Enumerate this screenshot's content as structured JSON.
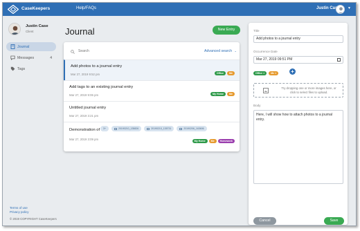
{
  "header": {
    "brand": "CaseKeepers",
    "help_link": "Help/FAQs",
    "user_name": "Justin Case"
  },
  "sidebar": {
    "user_name": "Justin Case",
    "user_role": "Client",
    "items": [
      {
        "label": "Journal",
        "icon": "book-icon",
        "active": true
      },
      {
        "label": "Messages",
        "icon": "chat-icon",
        "count": "4"
      },
      {
        "label": "Tags",
        "icon": "tag-icon"
      }
    ],
    "footer_links": [
      "Terms of use",
      "Privacy policy"
    ],
    "copyright": "© 2019 COPYRIGHT CaseKeepers"
  },
  "journal": {
    "title": "Journal",
    "new_entry_label": "New Entry",
    "search_placeholder": "Search",
    "advanced_search_label": "Advanced search",
    "entries": [
      {
        "title": "Add photos to a journal entry",
        "date": "Mar 27, 2019 9:52 pm",
        "tags": [
          "Office",
          "Me"
        ]
      },
      {
        "title": "Add tags to an existing journal entry",
        "date": "Mar 27, 2019 9:06 pm",
        "tags": [
          "My Home",
          "Me"
        ]
      },
      {
        "title": "Untitled journal entry",
        "date": "Mar 27, 2019 3:21 pm",
        "tags": []
      },
      {
        "title": "Demonstration of a ...",
        "date": "Mar 27, 2019 3:09 pm",
        "tags": [
          "My Home",
          "Me",
          "Homework"
        ],
        "attachments": [
          "3+",
          "20190210_135826",
          "20190210_135731",
          "20190206_163606"
        ]
      }
    ]
  },
  "editor": {
    "title_label": "Title",
    "title_value": "Add photos to a journal entry",
    "date_label": "Occurrence Date",
    "date_value": "Mar 27, 2019 09:51 PM",
    "tags": [
      "Office",
      "Me"
    ],
    "dropzone_text": "Try dropping one or more images here, or click to select files to upload.",
    "body_label": "Body",
    "body_value": "Here, I will show how to attach photos to a journal entry.",
    "cancel_label": "Cancel",
    "save_label": "Save"
  },
  "colors": {
    "brand_blue": "#2f6fb5",
    "green": "#3aaa53",
    "tag_office": "#2e9a4a",
    "tag_me": "#e69a2e",
    "tag_home": "#2e9a4a",
    "tag_homework": "#9b3fae"
  }
}
